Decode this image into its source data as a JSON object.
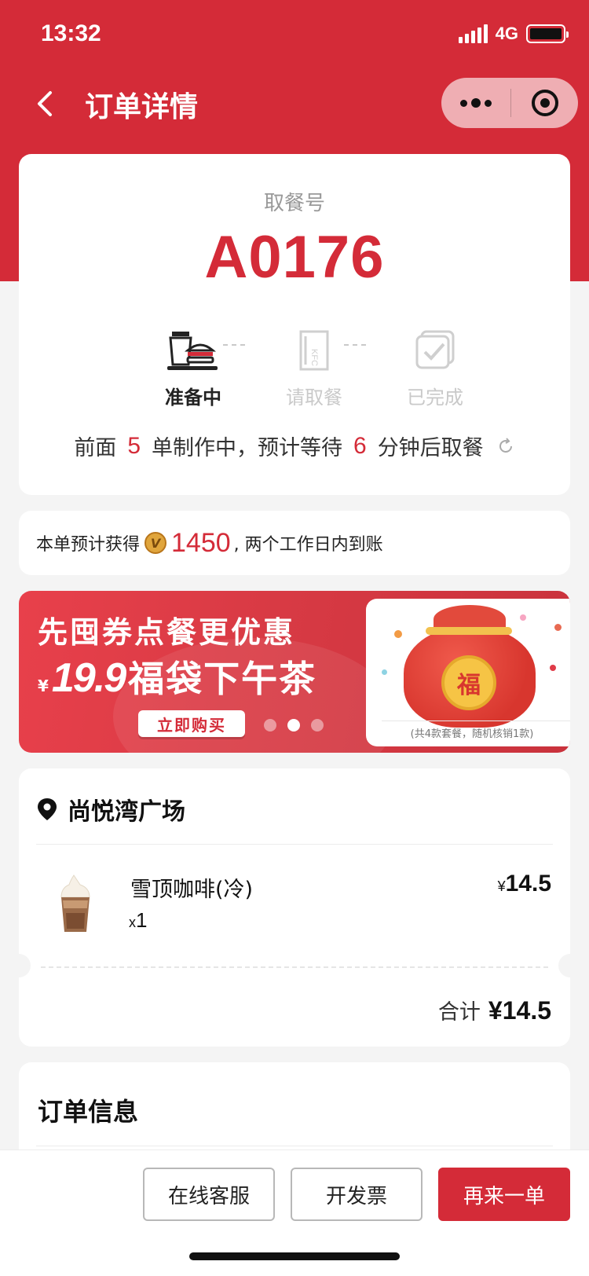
{
  "status_bar": {
    "time": "13:32",
    "network": "4G"
  },
  "nav": {
    "title": "订单详情"
  },
  "pickup": {
    "label": "取餐号",
    "number": "A0176",
    "steps": [
      {
        "label": "准备中",
        "icon": "burger-drink-icon",
        "active": true
      },
      {
        "label": "请取餐",
        "icon": "kfc-bag-icon",
        "active": false
      },
      {
        "label": "已完成",
        "icon": "completed-check-icon",
        "active": false
      }
    ],
    "wait": {
      "prefix": "前面",
      "orders_ahead": "5",
      "middle": "单制作中，预计等待",
      "minutes": "6",
      "suffix": "分钟后取餐"
    }
  },
  "points": {
    "prefix": "本单预计获得",
    "coin_letter": "V",
    "value": "1450",
    "suffix": ", 两个工作日内到账"
  },
  "banner": {
    "line1": "先囤券点餐更优惠",
    "currency": "¥",
    "price": "19.9",
    "line2": "福袋下午茶",
    "button": "立即购买",
    "bag_char": "福",
    "note": "(共4款套餐，随机核销1款)",
    "slide_index": 2,
    "slide_count": 3
  },
  "order": {
    "store": "尚悦湾广场",
    "items": [
      {
        "name": "雪顶咖啡(冷)",
        "qty_prefix": "x",
        "qty": "1",
        "currency": "¥",
        "price": "14.5"
      }
    ],
    "total_label": "合计",
    "total_value": "¥14.5"
  },
  "info": {
    "title": "订单信息"
  },
  "actions": {
    "customer_service": "在线客服",
    "invoice": "开发票",
    "reorder": "再来一单"
  },
  "colors": {
    "brand_red": "#d42b38",
    "background": "#f4f4f4"
  }
}
